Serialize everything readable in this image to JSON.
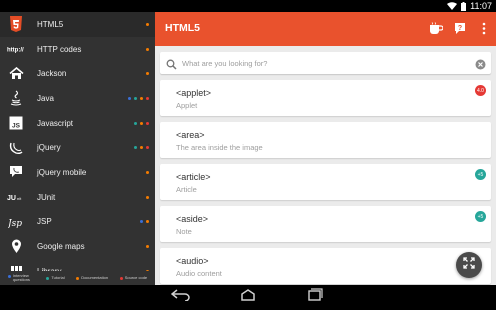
{
  "status": {
    "time": "11:07"
  },
  "app": {
    "title": "HTML5",
    "accent": "#e9522d"
  },
  "search": {
    "placeholder": "What are you looking for?"
  },
  "dot_colors": {
    "blue": "#3a6fd8",
    "teal": "#26a69a",
    "orange": "#f57c00",
    "red": "#e53935"
  },
  "sidebar": {
    "items": [
      {
        "label": "HTML5",
        "icon": "html5-icon",
        "dots": [
          "orange"
        ]
      },
      {
        "label": "HTTP codes",
        "icon": "http-icon",
        "dots": [
          "orange"
        ]
      },
      {
        "label": "Jackson",
        "icon": "house-icon",
        "dots": [
          "orange"
        ]
      },
      {
        "label": "Java",
        "icon": "java-icon",
        "dots": [
          "blue",
          "teal",
          "orange",
          "red"
        ]
      },
      {
        "label": "Javascript",
        "icon": "javascript-icon",
        "dots": [
          "teal",
          "orange",
          "red"
        ]
      },
      {
        "label": "jQuery",
        "icon": "jquery-icon",
        "dots": [
          "teal",
          "orange",
          "red"
        ]
      },
      {
        "label": "jQuery mobile",
        "icon": "jquery-mobile-icon",
        "dots": [
          "orange"
        ]
      },
      {
        "label": "JUnit",
        "icon": "junit-icon",
        "dots": [
          "orange"
        ]
      },
      {
        "label": "JSP",
        "icon": "jsp-icon",
        "dots": [
          "blue",
          "orange"
        ]
      },
      {
        "label": "Google maps",
        "icon": "map-pin-icon",
        "dots": [
          "orange"
        ]
      },
      {
        "label": "Library",
        "icon": "library-icon",
        "dots": [
          "orange"
        ]
      }
    ],
    "legend": [
      {
        "label": "Interview questions",
        "color": "#3a6fd8"
      },
      {
        "label": "Tutorial",
        "color": "#26a69a"
      },
      {
        "label": "Documentation",
        "color": "#f57c00"
      },
      {
        "label": "Source code",
        "color": "#e53935"
      }
    ]
  },
  "cards": [
    {
      "title": "<applet>",
      "subtitle": "Applet",
      "badge": "4.0",
      "badge_color": "#e53935"
    },
    {
      "title": "<area>",
      "subtitle": "The area inside the image",
      "badge": "",
      "badge_color": ""
    },
    {
      "title": "<article>",
      "subtitle": "Article",
      "badge": "+5",
      "badge_color": "#26a69a"
    },
    {
      "title": "<aside>",
      "subtitle": "Note",
      "badge": "+5",
      "badge_color": "#26a69a"
    },
    {
      "title": "<audio>",
      "subtitle": "Audio content",
      "badge": "",
      "badge_color": ""
    }
  ]
}
